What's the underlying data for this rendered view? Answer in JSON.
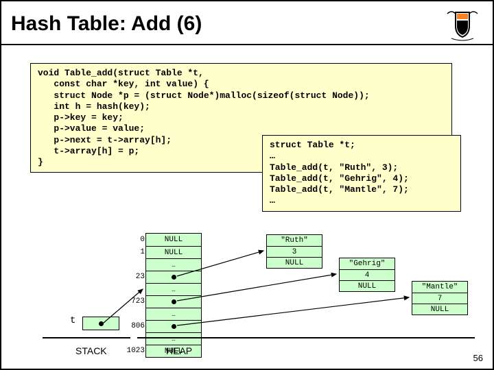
{
  "title": "Hash Table: Add (6)",
  "code_main": "void Table_add(struct Table *t,\n   const char *key, int value) {\n   struct Node *p = (struct Node*)malloc(sizeof(struct Node));\n   int h = hash(key);\n   p->key = key;\n   p->value = value;\n   p->next = t->array[h];\n   t->array[h] = p;\n}",
  "code_calls": "struct Table *t;\n…\nTable_add(t, \"Ruth\", 3);\nTable_add(t, \"Gehrig\", 4);\nTable_add(t, \"Mantle\", 7);\n…",
  "array": {
    "indices": [
      "0",
      "1",
      "",
      "23",
      "",
      "723",
      "",
      "806",
      "",
      "1023"
    ],
    "values": [
      "NULL",
      "NULL",
      "…",
      "",
      "…",
      "",
      "…",
      "",
      "…",
      "NULL"
    ]
  },
  "nodes": {
    "ruth": {
      "key": "\"Ruth\"",
      "value": "3",
      "next": "NULL"
    },
    "gehrig": {
      "key": "\"Gehrig\"",
      "value": "4",
      "next": "NULL"
    },
    "mantle": {
      "key": "\"Mantle\"",
      "value": "7",
      "next": "NULL"
    }
  },
  "labels": {
    "t": "t",
    "stack": "STACK",
    "heap": "HEAP",
    "page": "56"
  }
}
